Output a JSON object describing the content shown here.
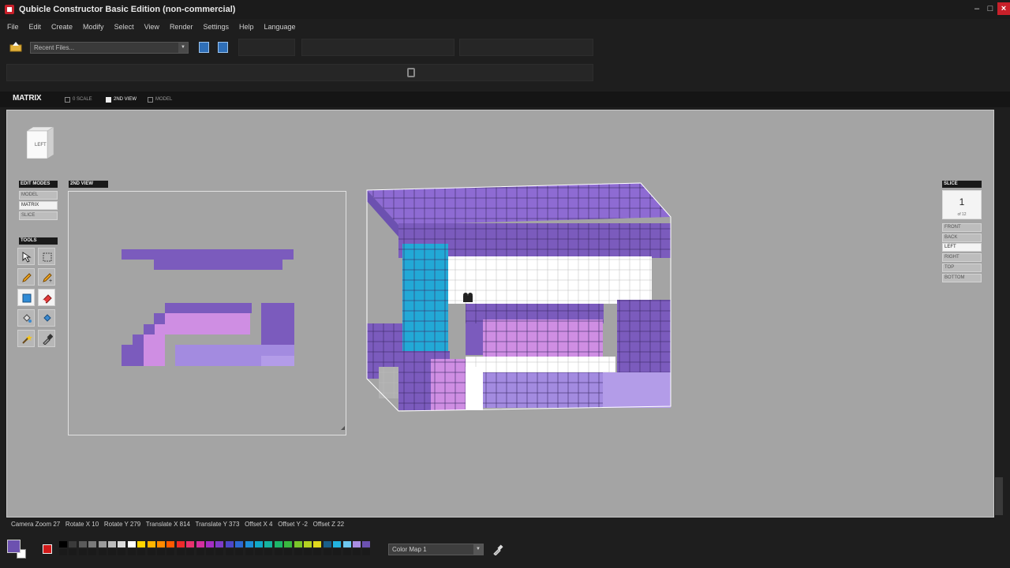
{
  "window": {
    "title": "Qubicle Constructor Basic Edition (non-commercial)"
  },
  "menu": [
    "File",
    "Edit",
    "Create",
    "Modify",
    "Select",
    "View",
    "Render",
    "Settings",
    "Help",
    "Language"
  ],
  "toolbar": {
    "recent_files": "Recent Files..."
  },
  "matrix": {
    "title": "MATRIX",
    "views": [
      {
        "label": "0 SCALE",
        "on": false
      },
      {
        "label": "2ND VIEW",
        "on": true
      },
      {
        "label": "MODEL",
        "on": false
      }
    ]
  },
  "nav_cube": {
    "label": "LEFT"
  },
  "edit_modes": {
    "header": "EDIT MODES",
    "items": [
      {
        "label": "MODEL",
        "on": false
      },
      {
        "label": "MATRIX",
        "on": true
      },
      {
        "label": "SLICE",
        "on": false
      }
    ]
  },
  "tools": {
    "header": "TOOLS",
    "items": [
      "move-tool",
      "select-tool",
      "pencil-tool",
      "paint-tool",
      "box-tool",
      "eraser-tool",
      "fill-tool",
      "fill-color-tool",
      "magic-wand-tool",
      "eyedropper-tool"
    ],
    "active": [
      "box-tool",
      "eraser-tool"
    ]
  },
  "second_view": {
    "header": "2ND VIEW"
  },
  "slice": {
    "header": "SLICE",
    "number": "1",
    "of": "of 12",
    "sides": [
      {
        "label": "FRONT",
        "on": false
      },
      {
        "label": "BACK",
        "on": false
      },
      {
        "label": "LEFT",
        "on": true
      },
      {
        "label": "RIGHT",
        "on": false
      },
      {
        "label": "TOP",
        "on": false
      },
      {
        "label": "BOTTOM",
        "on": false
      }
    ]
  },
  "status": {
    "camera_zoom": "Camera Zoom 27",
    "rotate_x": "Rotate X 10",
    "rotate_y": "Rotate Y 279",
    "translate_x": "Translate X 814",
    "translate_y": "Translate Y 373",
    "offset_x": "Offset X 4",
    "offset_y": "Offset Y -2",
    "offset_z": "Offset Z 22"
  },
  "colors": {
    "accent_purple": "#6c51b0",
    "light_purple": "#cf8ee3",
    "lavender": "#a38be0",
    "cyan": "#22a9d6",
    "palette": [
      "#000000",
      "#3a3a3a",
      "#5a5a5a",
      "#7a7a7a",
      "#9a9a9a",
      "#bdbdbd",
      "#dcdcdc",
      "#ffffff",
      "#ffd400",
      "#ffb400",
      "#ff8a00",
      "#ff5a00",
      "#ee2a2a",
      "#e8326e",
      "#d42f9f",
      "#a52ec4",
      "#7f3cc8",
      "#4d47c8",
      "#2d69d2",
      "#1d8fd8",
      "#10a9c8",
      "#15b3a0",
      "#1db56a",
      "#39b840",
      "#7bc52a",
      "#b5d222",
      "#e2d81e",
      "#1a5f8a",
      "#23b3e0",
      "#6ec8f0",
      "#a98ee3",
      "#6c51b0"
    ]
  },
  "colormap": {
    "label": "Color Map 1"
  }
}
